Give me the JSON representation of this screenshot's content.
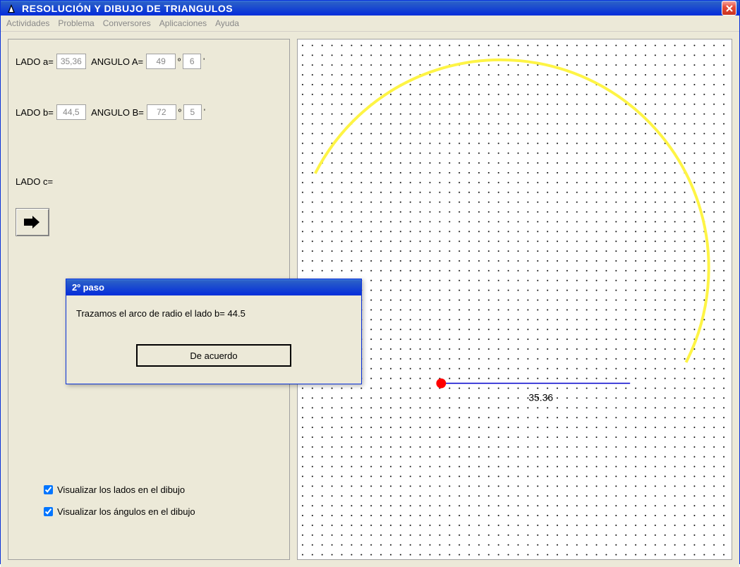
{
  "window": {
    "title": "RESOLUCIÓN Y DIBUJO DE TRIANGULOS"
  },
  "menu": {
    "actividades": "Actividades",
    "problema": "Problema",
    "conversores": "Conversores",
    "aplicaciones": "Aplicaciones",
    "ayuda": "Ayuda"
  },
  "inputs": {
    "lado_a_label": "LADO a=",
    "lado_a": "35,36",
    "angulo_a_label": "ANGULO A=",
    "angulo_a_deg": "49",
    "angulo_a_min": "6",
    "lado_b_label": "LADO b=",
    "lado_b": "44,5",
    "angulo_b_label": "ANGULO B=",
    "angulo_b_deg": "72",
    "angulo_b_min": "5",
    "lado_c_label": "LADO c=",
    "deg_symbol": "º",
    "min_symbol": "'"
  },
  "checks": {
    "lados": "Visualizar los lados en el dibujo",
    "angulos": "Visualizar los ángulos en el dibujo"
  },
  "dialog": {
    "title": "2º paso",
    "message": "Trazamos el arco de radio el lado b= 44.5",
    "ok": "De acuerdo"
  },
  "chart_data": {
    "type": "diagram",
    "segment_label": "35.36",
    "point_color": "#ff0000",
    "segment_color": "#0000cc",
    "arc_color": "#fef445",
    "arc_radius_b": 44.5
  }
}
